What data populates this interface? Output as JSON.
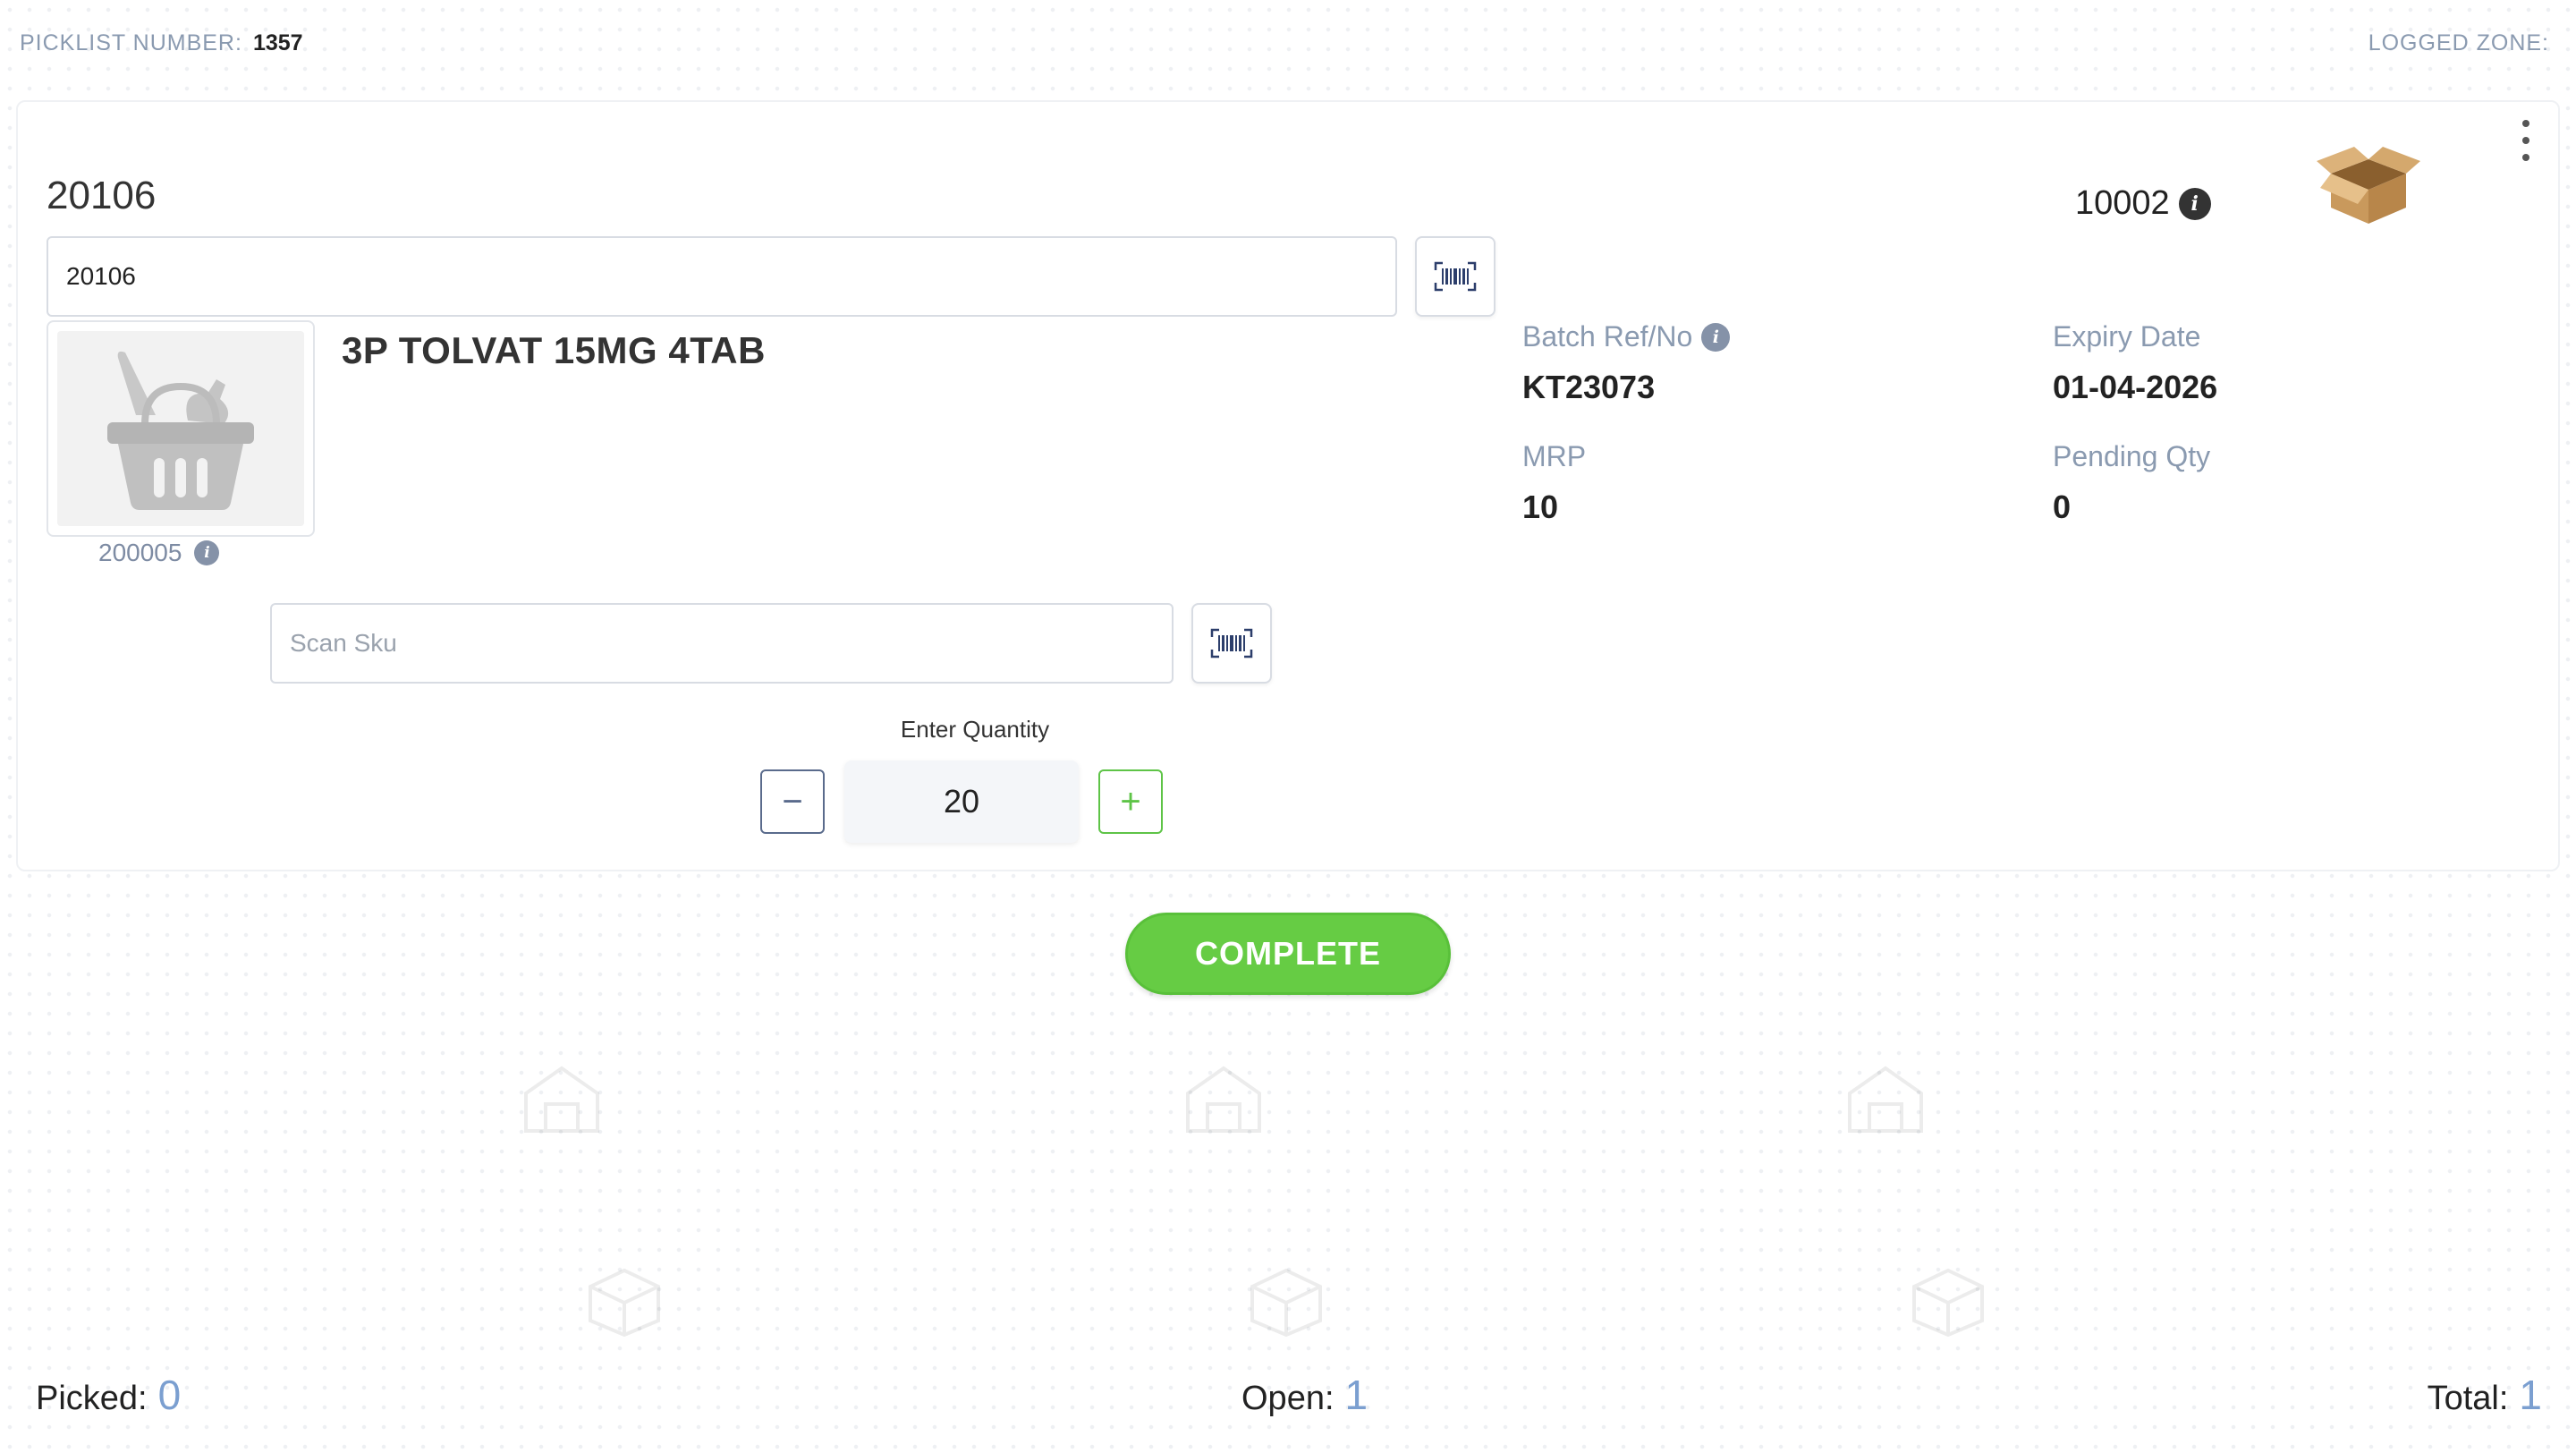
{
  "header": {
    "picklist_label": "PICKLIST NUMBER:",
    "picklist_number": "1357",
    "zone_label": "LOGGED ZONE:"
  },
  "card": {
    "location_code": "20106",
    "location_input_value": "20106",
    "tote_number": "10002",
    "product_name": "3P TOLVAT 15MG 4TAB",
    "sku_code": "200005",
    "batch_label": "Batch Ref/No",
    "batch_value": "KT23073",
    "expiry_label": "Expiry Date",
    "expiry_value": "01-04-2026",
    "mrp_label": "MRP",
    "mrp_value": "10",
    "pending_label": "Pending Qty",
    "pending_value": "0",
    "scan_sku_placeholder": "Scan Sku",
    "qty_label": "Enter Quantity",
    "qty_value": "20",
    "minus_symbol": "−",
    "plus_symbol": "+",
    "info_symbol": "i"
  },
  "actions": {
    "complete_label": "COMPLETE"
  },
  "footer": {
    "picked_label": "Picked:",
    "picked_value": "0",
    "open_label": "Open:",
    "open_value": "1",
    "total_label": "Total:",
    "total_value": "1"
  },
  "icons": {
    "barcode": "barcode-scan-icon",
    "info": "info-icon",
    "kebab": "more-vertical-icon",
    "box": "open-box-icon",
    "basket": "shopping-basket-icon"
  },
  "colors": {
    "accent_green": "#66cc44",
    "label_gray": "#8a9ab0",
    "count_blue": "#7b9fd0",
    "minus_border": "#5a6b8c"
  }
}
